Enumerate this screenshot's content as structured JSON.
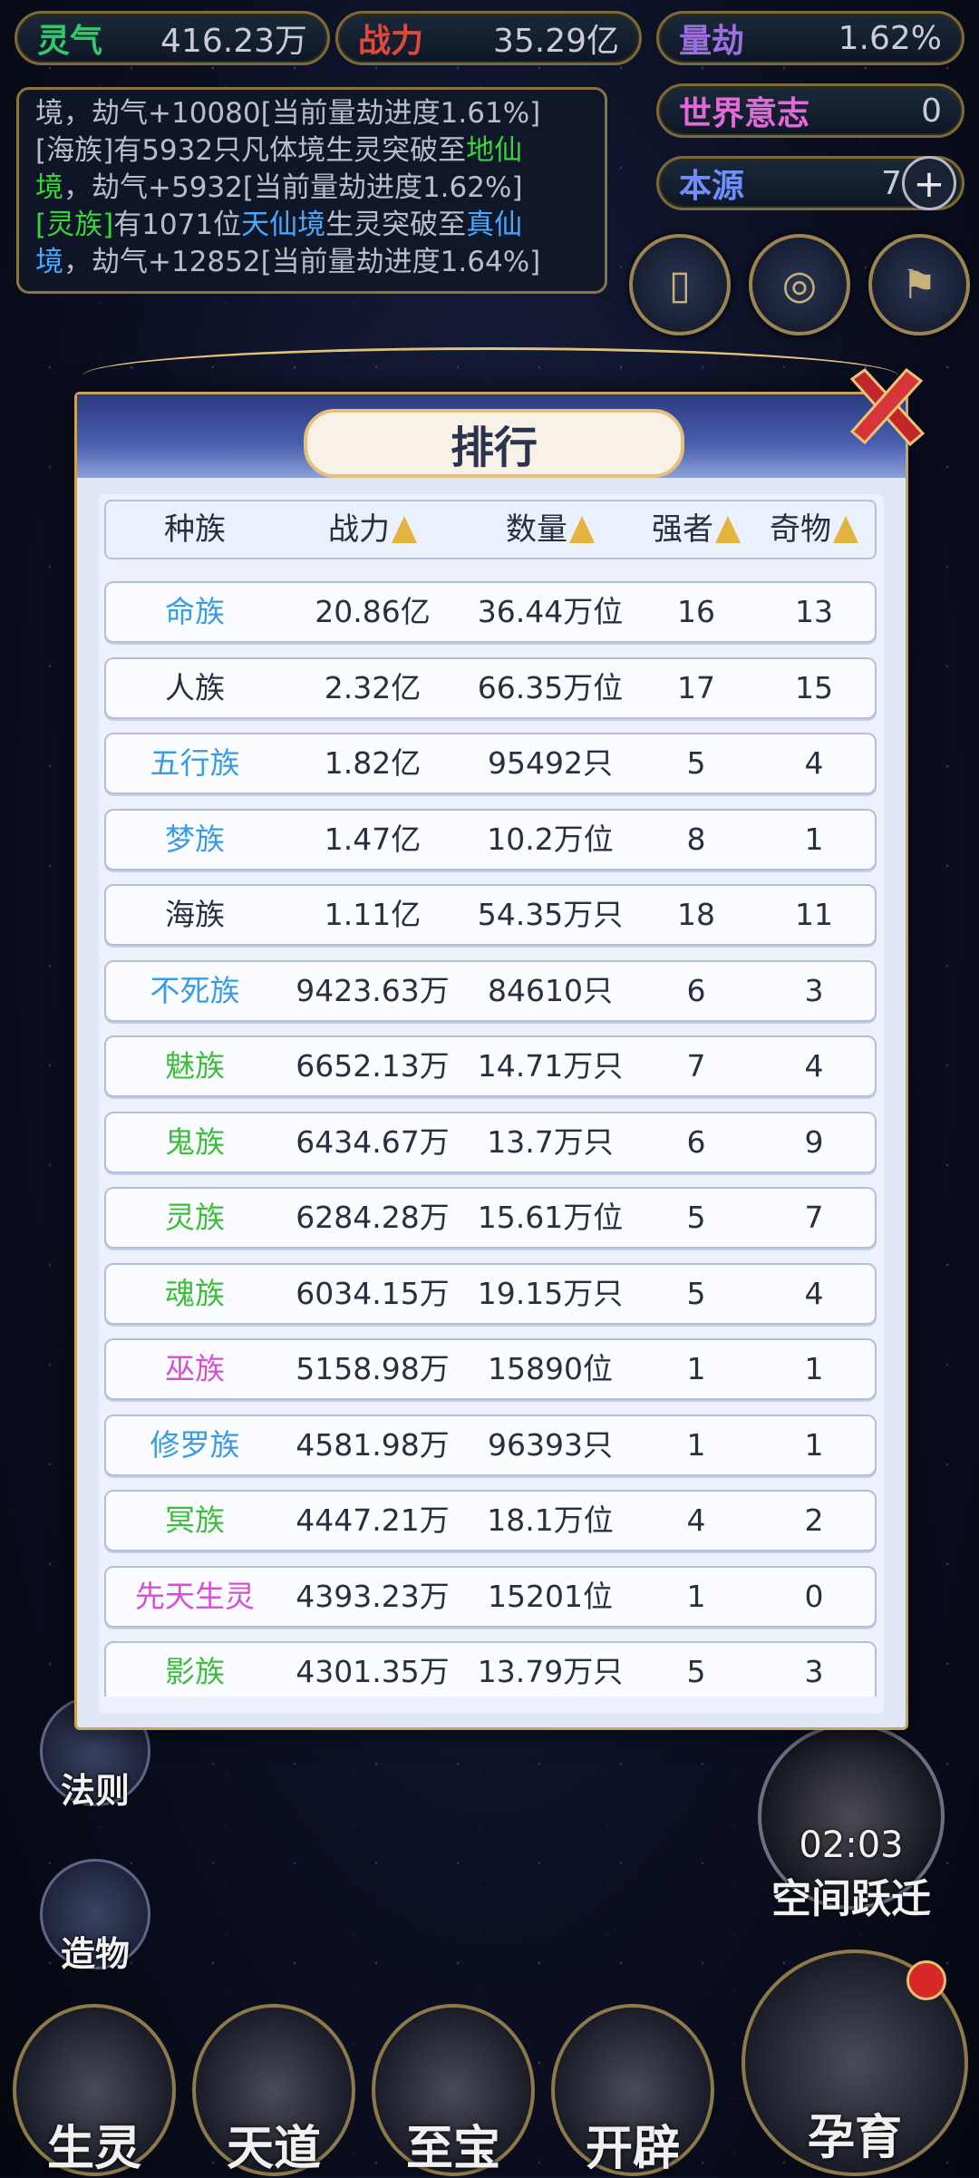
{
  "resources": {
    "lingqi": {
      "label": "灵气",
      "value": "416.23万"
    },
    "zhanli": {
      "label": "战力",
      "value": "35.29亿"
    },
    "liangjie": {
      "label": "量劫",
      "value": "1.62%"
    },
    "shijie": {
      "label": "世界意志",
      "value": "0"
    },
    "benyuan": {
      "label": "本源",
      "value": "7"
    }
  },
  "log": {
    "line1": "境，劫气+10080[当前量劫进度1.61%]",
    "line2a": "[海族]有5932只凡体境生灵突破至",
    "line2b": "地仙",
    "line3a": "境",
    "line3b": "，劫气+5932[当前量劫进度1.62%]",
    "line4a": "[灵族]",
    "line4b": "有1071位",
    "line4c": "天仙境",
    "line4d": "生灵突破至",
    "line4e": "真仙",
    "line5a": "境",
    "line5b": "，劫气+12852[当前量劫进度1.64%]"
  },
  "side_buttons": {
    "faze": "法则",
    "zaowu": "造物",
    "timer": "02:03",
    "space_jump": "空间跃迁"
  },
  "bottom_nav": {
    "shengling": "生灵",
    "tiandao": "天道",
    "zhibao": "至宝",
    "kaipi": "开辟",
    "yunyu": "孕育"
  },
  "modal": {
    "title": "排行",
    "headers": {
      "race": "种族",
      "power": "战力",
      "count": "数量",
      "strong": "强者",
      "treasure": "奇物"
    },
    "rows": [
      {
        "race": "命族",
        "power": "20.86亿",
        "count": "36.44万位",
        "strong": "16",
        "treasure": "13",
        "color": "#3a9be0"
      },
      {
        "race": "人族",
        "power": "2.32亿",
        "count": "66.35万位",
        "strong": "17",
        "treasure": "15",
        "color": "#2a2f40"
      },
      {
        "race": "五行族",
        "power": "1.82亿",
        "count": "95492只",
        "strong": "5",
        "treasure": "4",
        "color": "#3a9be0"
      },
      {
        "race": "梦族",
        "power": "1.47亿",
        "count": "10.2万位",
        "strong": "8",
        "treasure": "1",
        "color": "#3a9be0"
      },
      {
        "race": "海族",
        "power": "1.11亿",
        "count": "54.35万只",
        "strong": "18",
        "treasure": "11",
        "color": "#2a2f40"
      },
      {
        "race": "不死族",
        "power": "9423.63万",
        "count": "84610只",
        "strong": "6",
        "treasure": "3",
        "color": "#3a9be0"
      },
      {
        "race": "魅族",
        "power": "6652.13万",
        "count": "14.71万只",
        "strong": "7",
        "treasure": "4",
        "color": "#3cbd3c"
      },
      {
        "race": "鬼族",
        "power": "6434.67万",
        "count": "13.7万只",
        "strong": "6",
        "treasure": "9",
        "color": "#3cbd3c"
      },
      {
        "race": "灵族",
        "power": "6284.28万",
        "count": "15.61万位",
        "strong": "5",
        "treasure": "7",
        "color": "#3cbd3c"
      },
      {
        "race": "魂族",
        "power": "6034.15万",
        "count": "19.15万只",
        "strong": "5",
        "treasure": "4",
        "color": "#3cbd3c"
      },
      {
        "race": "巫族",
        "power": "5158.98万",
        "count": "15890位",
        "strong": "1",
        "treasure": "1",
        "color": "#d44fd4"
      },
      {
        "race": "修罗族",
        "power": "4581.98万",
        "count": "96393只",
        "strong": "1",
        "treasure": "1",
        "color": "#3a9be0"
      },
      {
        "race": "冥族",
        "power": "4447.21万",
        "count": "18.1万位",
        "strong": "4",
        "treasure": "2",
        "color": "#3cbd3c"
      },
      {
        "race": "先天生灵",
        "power": "4393.23万",
        "count": "15201位",
        "strong": "1",
        "treasure": "0",
        "color": "#d44fd4"
      },
      {
        "race": "影族",
        "power": "4301.35万",
        "count": "13.79万只",
        "strong": "5",
        "treasure": "3",
        "color": "#3cbd3c"
      }
    ]
  }
}
